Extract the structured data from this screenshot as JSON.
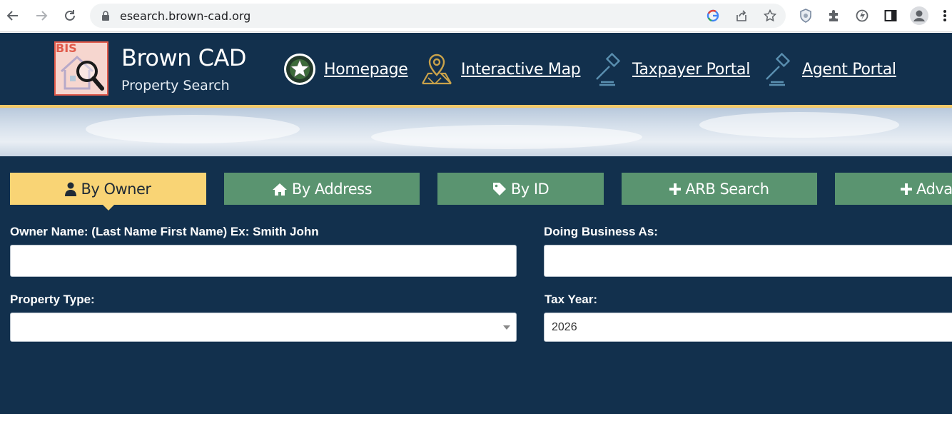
{
  "browser": {
    "url": "esearch.brown-cad.org",
    "icons": [
      "back-arrow-icon",
      "forward-arrow-icon",
      "reload-icon",
      "lock-icon",
      "google-icon",
      "share-icon",
      "star-icon",
      "shield-extension-icon",
      "puzzle-icon",
      "speed-icon",
      "side-panel-icon",
      "profile-icon",
      "kebab-menu-icon"
    ]
  },
  "header": {
    "logo_badge": "BIS",
    "title": "Brown CAD",
    "subtitle": "Property Search",
    "nav": [
      {
        "label": "Homepage",
        "icon": "star-seal-icon"
      },
      {
        "label": "Interactive Map",
        "icon": "map-pin-icon"
      },
      {
        "label": "Taxpayer Portal",
        "icon": "gavel-icon"
      },
      {
        "label": "Agent Portal",
        "icon": "gavel-icon"
      }
    ]
  },
  "tabs": [
    {
      "label": "By Owner",
      "icon": "user-icon",
      "active": true
    },
    {
      "label": "By Address",
      "icon": "home-icon",
      "active": false
    },
    {
      "label": "By ID",
      "icon": "tag-icon",
      "active": false
    },
    {
      "label": "ARB Search",
      "icon": "plus-icon",
      "active": false
    },
    {
      "label": "Adva",
      "icon": "plus-icon",
      "active": false
    }
  ],
  "form": {
    "owner_name_label": "Owner Name: (Last Name First Name) Ex: Smith John",
    "owner_name_value": "",
    "dba_label": "Doing Business As:",
    "dba_value": "",
    "property_type_label": "Property Type:",
    "property_type_value": "",
    "tax_year_label": "Tax Year:",
    "tax_year_value": "2026"
  },
  "colors": {
    "header_bg": "#12304d",
    "tab_green": "#5a9470",
    "tab_active": "#f9d475",
    "accent": "#f2c96a"
  }
}
